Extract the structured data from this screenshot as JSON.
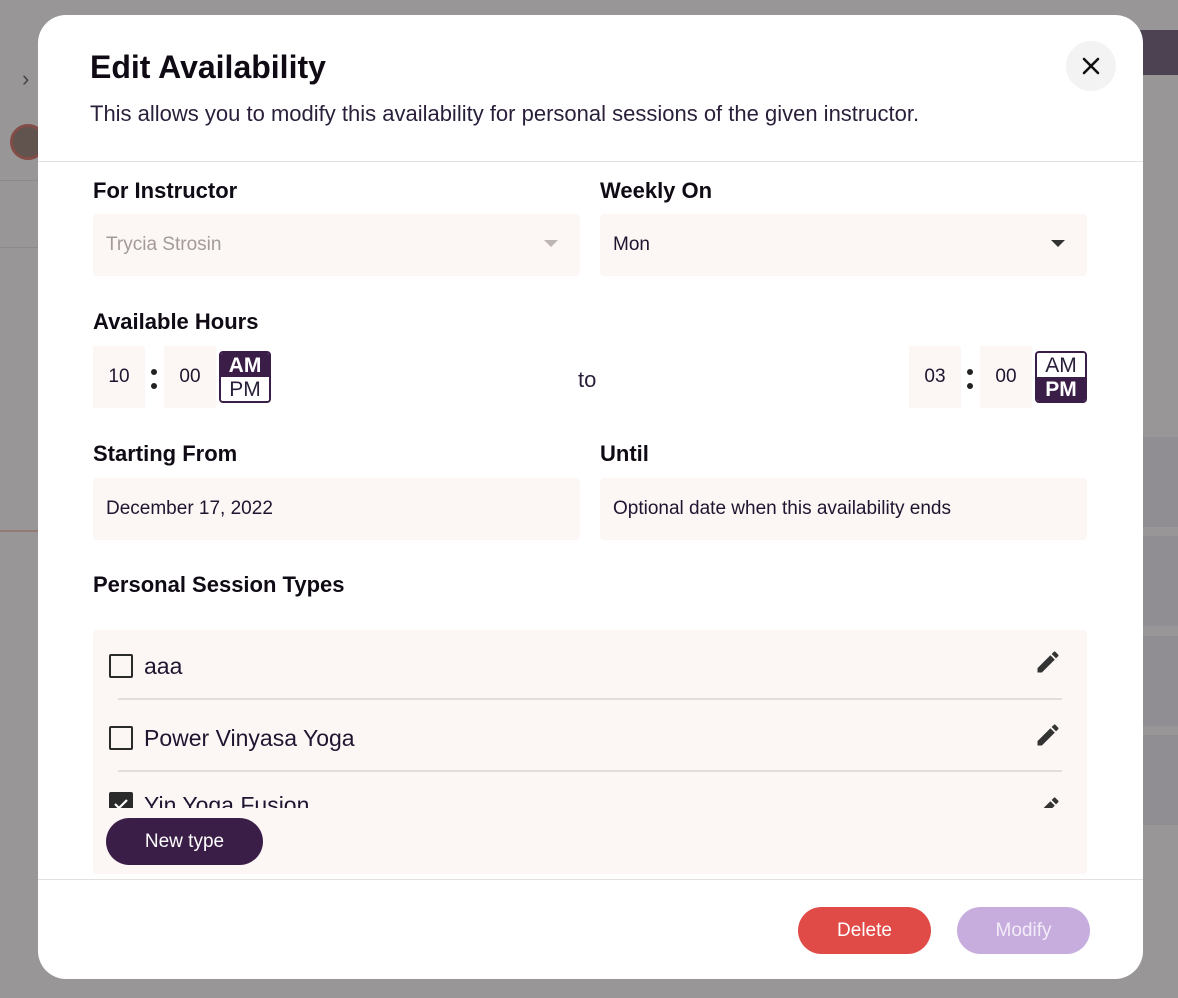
{
  "modal": {
    "title": "Edit Availability",
    "subtitle": "This allows you to modify this availability for personal sessions of the given instructor.",
    "close_label": "✕"
  },
  "instructor": {
    "label": "For Instructor",
    "value": "Trycia Strosin"
  },
  "weekly": {
    "label": "Weekly On",
    "value": "Mon"
  },
  "hours": {
    "label": "Available Hours",
    "start_hour": "10",
    "start_minute": "00",
    "start_period": "AM",
    "to_label": "to",
    "end_hour": "03",
    "end_minute": "00",
    "end_period": "PM",
    "am_label": "AM",
    "pm_label": "PM"
  },
  "starting": {
    "label": "Starting From",
    "value": "December 17, 2022"
  },
  "until": {
    "label": "Until",
    "placeholder": "Optional date when this availability ends"
  },
  "session_types": {
    "label": "Personal Session Types",
    "items": [
      {
        "name": "aaa",
        "checked": false
      },
      {
        "name": "Power Vinyasa Yoga",
        "checked": false
      },
      {
        "name": "Yin Yoga Fusion",
        "checked": true
      }
    ],
    "new_type_label": "New type"
  },
  "footer": {
    "delete_label": "Delete",
    "modify_label": "Modify"
  },
  "colors": {
    "primary": "#3b1e48",
    "danger": "#e04b47",
    "disabled": "#c7addd",
    "field_bg": "#fcf6f4"
  }
}
